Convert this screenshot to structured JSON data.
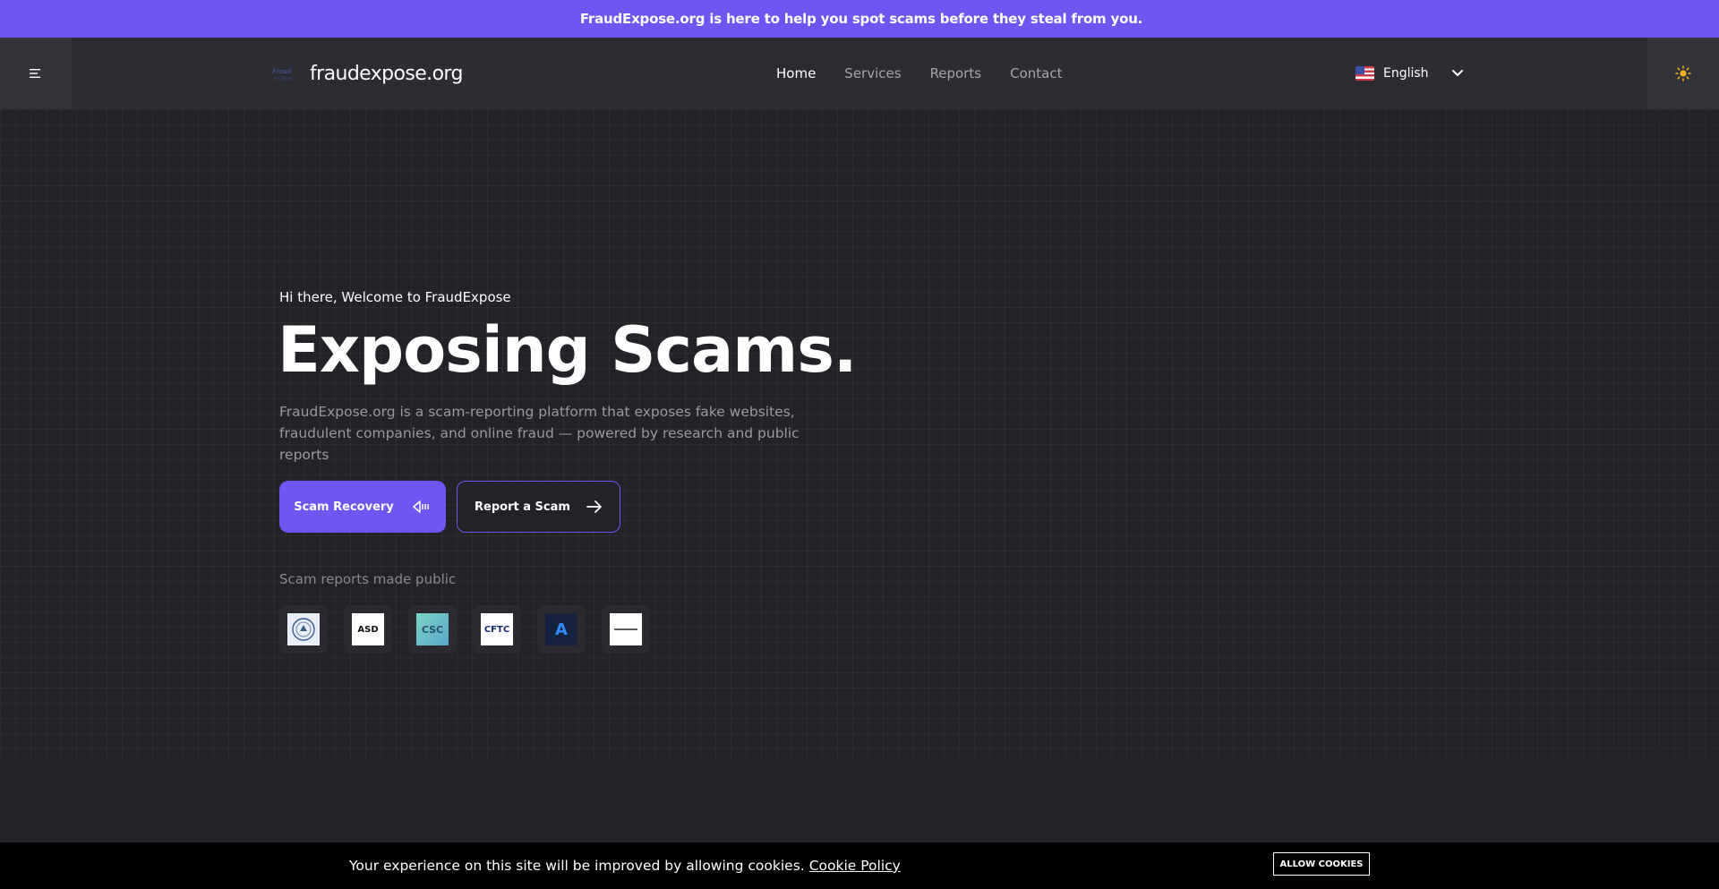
{
  "announcement": {
    "glyph": "",
    "text": "FraudExpose.org is here to help you spot scams before they steal from you."
  },
  "header": {
    "logo_text": "fraudexpose.org",
    "nav": [
      {
        "label": "Home",
        "active": true
      },
      {
        "label": "Services",
        "active": false
      },
      {
        "label": "Reports",
        "active": false
      },
      {
        "label": "Contact",
        "active": false
      }
    ],
    "language": {
      "label": "English",
      "flag": "us-flag-icon"
    },
    "menu_icon": "hamburger-menu-icon",
    "theme_icon": "sun-icon"
  },
  "hero": {
    "greeting_glyph": "",
    "greeting": "Hi there, Welcome to FraudExpose",
    "headline": "Exposing Scams.",
    "subtext": "FraudExpose.org is a scam-reporting platform that exposes fake websites, fraudulent companies, and online fraud — powered by research and public reports",
    "primary_button": "Scam Recovery",
    "secondary_button": "Report a Scam",
    "reports_label": "Scam reports made public",
    "partner_logos": [
      {
        "name": "seal-logo",
        "text": ""
      },
      {
        "name": "asd-logo",
        "text": "ASD"
      },
      {
        "name": "csc-logo",
        "text": "CSC"
      },
      {
        "name": "cftc-logo",
        "text": "CFTC"
      },
      {
        "name": "atomic-logo",
        "text": "A"
      },
      {
        "name": "chainalysis-logo",
        "text": ""
      }
    ]
  },
  "cookie": {
    "text": "Your experience on this site will be improved by allowing cookies.",
    "link": "Cookie Policy",
    "button": "ALLOW COOKIES"
  },
  "colors": {
    "accent": "#6e56f2",
    "announce_bg": "#6c55f0",
    "page_bg": "#232228",
    "header_bg": "#2c2c33"
  }
}
